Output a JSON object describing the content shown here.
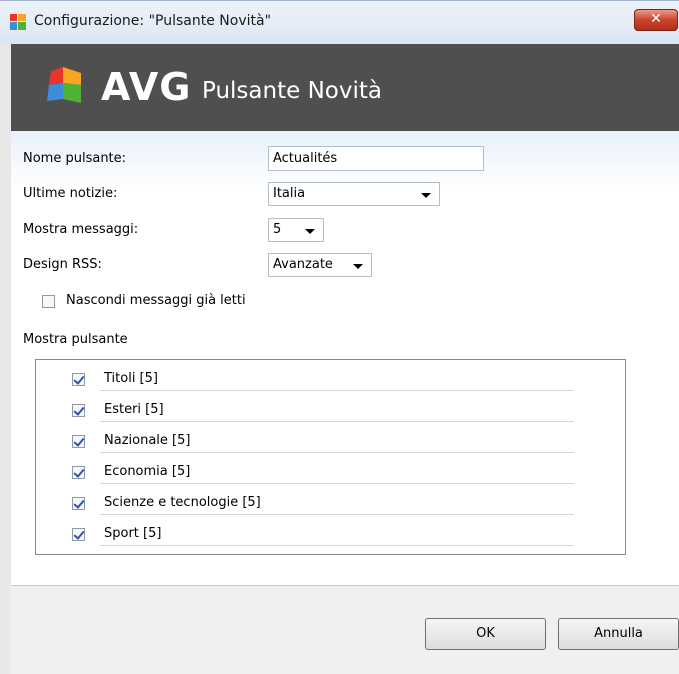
{
  "window": {
    "title": "Configurazione: \"Pulsante Novità\"",
    "close_label": "✕"
  },
  "header": {
    "logo_text": "AVG",
    "title": "Pulsante Novità"
  },
  "form": {
    "button_name_label": "Nome pulsante:",
    "button_name_value": "Actualités",
    "latest_news_label": "Ultime notizie:",
    "latest_news_value": "Italia",
    "show_messages_label": "Mostra messaggi:",
    "show_messages_value": "5",
    "rss_design_label": "Design RSS:",
    "rss_design_value": "Avanzate",
    "hide_read_label": "Nascondi messaggi già letti",
    "hide_read_checked": false
  },
  "show_button": {
    "label": "Mostra pulsante",
    "items": [
      {
        "label": "Titoli [5]",
        "checked": true
      },
      {
        "label": "Esteri [5]",
        "checked": true
      },
      {
        "label": "Nazionale [5]",
        "checked": true
      },
      {
        "label": "Economia [5]",
        "checked": true
      },
      {
        "label": "Scienze e tecnologie [5]",
        "checked": true
      },
      {
        "label": "Sport [5]",
        "checked": true
      }
    ]
  },
  "footer": {
    "ok_label": "OK",
    "cancel_label": "Annulla"
  },
  "colors": {
    "header_bg": "#4f4f4f",
    "close_red": "#c8442c",
    "checkmark": "#2e56a6"
  }
}
